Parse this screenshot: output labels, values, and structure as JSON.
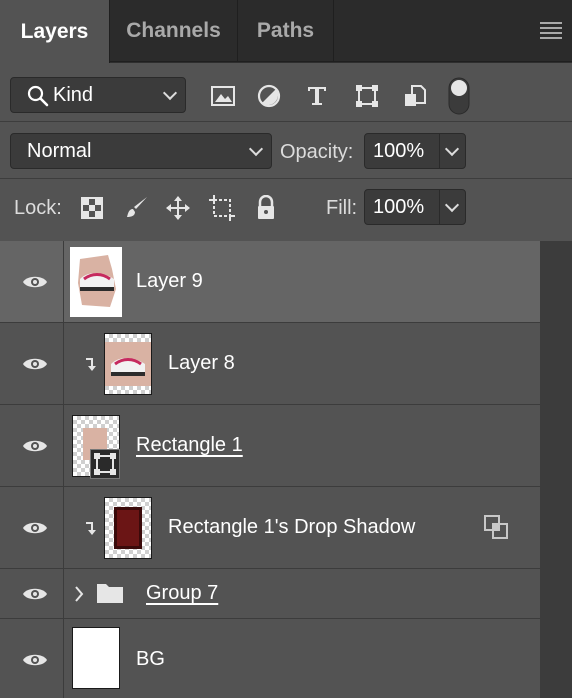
{
  "tabs": [
    {
      "label": "Layers",
      "active": true
    },
    {
      "label": "Channels",
      "active": false
    },
    {
      "label": "Paths",
      "active": false
    }
  ],
  "filter": {
    "kind_label": "Kind",
    "icons": [
      "image-filter-icon",
      "adjustment-filter-icon",
      "type-filter-icon",
      "shape-filter-icon",
      "smart-object-filter-icon",
      "filter-toggle-icon"
    ]
  },
  "blend": {
    "mode": "Normal",
    "opacity_label": "Opacity:",
    "opacity_value": "100%"
  },
  "lock": {
    "label": "Lock:",
    "icons": [
      "lock-transparent-pixels-icon",
      "lock-image-pixels-icon",
      "lock-position-icon",
      "lock-artboard-icon",
      "lock-all-icon"
    ],
    "fill_label": "Fill:",
    "fill_value": "100%"
  },
  "layers": [
    {
      "name": "Layer 9",
      "selected": true,
      "clipped": false,
      "underline": false
    },
    {
      "name": "Layer 8",
      "selected": false,
      "clipped": true,
      "underline": false
    },
    {
      "name": "Rectangle 1",
      "selected": false,
      "clipped": false,
      "underline": true
    },
    {
      "name": "Rectangle 1's Drop Shadow",
      "selected": false,
      "clipped": true,
      "underline": false
    },
    {
      "name": "Group 7",
      "selected": false,
      "clipped": false,
      "underline": true
    },
    {
      "name": "BG",
      "selected": false,
      "clipped": false,
      "underline": false
    }
  ],
  "colors": {
    "panel_bg": "#535353",
    "selected_row": "#656565",
    "tab_bar": "#2b2b2b",
    "thumb_skin": "#d9b2a3",
    "drop_shadow": "#6b1515"
  }
}
